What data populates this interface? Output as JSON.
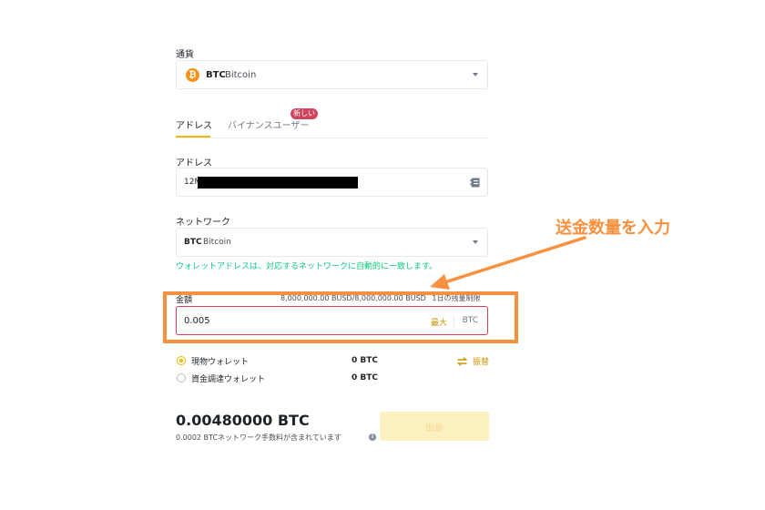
{
  "currency": {
    "label": "通貨",
    "symbol": "BTC",
    "name": "Bitcoin",
    "icon": "bitcoin-icon"
  },
  "tabs": [
    {
      "label": "アドレス",
      "active": true
    },
    {
      "label": "バイナンスユーザー",
      "active": false,
      "badge": "新しい"
    }
  ],
  "address": {
    "label": "アドレス",
    "value_prefix": "12M",
    "redacted": true,
    "icon": "address-book-icon"
  },
  "network": {
    "label": "ネットワーク",
    "symbol": "BTC",
    "name": "Bitcoin",
    "hint": "ウォレットアドレスは、対応するネットワークに自動的に一致します。"
  },
  "amount": {
    "label": "金額",
    "limit": "8,000,000.00 BUSD/8,000,000.00 BUSD",
    "limit_suffix": "1日の残量制限",
    "value": "0.005",
    "max_label": "最大",
    "unit": "BTC"
  },
  "wallets": [
    {
      "label": "現物ウォレット",
      "balance": "0 BTC",
      "selected": true
    },
    {
      "label": "資金調達ウォレット",
      "balance": "0 BTC",
      "selected": false
    }
  ],
  "transfer": {
    "label": "振替",
    "icon": "swap-icon"
  },
  "receive": {
    "amount": "0.00480000 BTC",
    "fee_note": "0.0002 BTCネットワーク手数料が含まれています",
    "info_icon": "info-icon"
  },
  "withdraw_button": {
    "label": "出金"
  },
  "annotation": {
    "text": "送金数量を入力"
  },
  "colors": {
    "accent": "#f0b90b",
    "annotation": "#f7913f",
    "success": "#0ecb81",
    "error": "#d0425e"
  }
}
